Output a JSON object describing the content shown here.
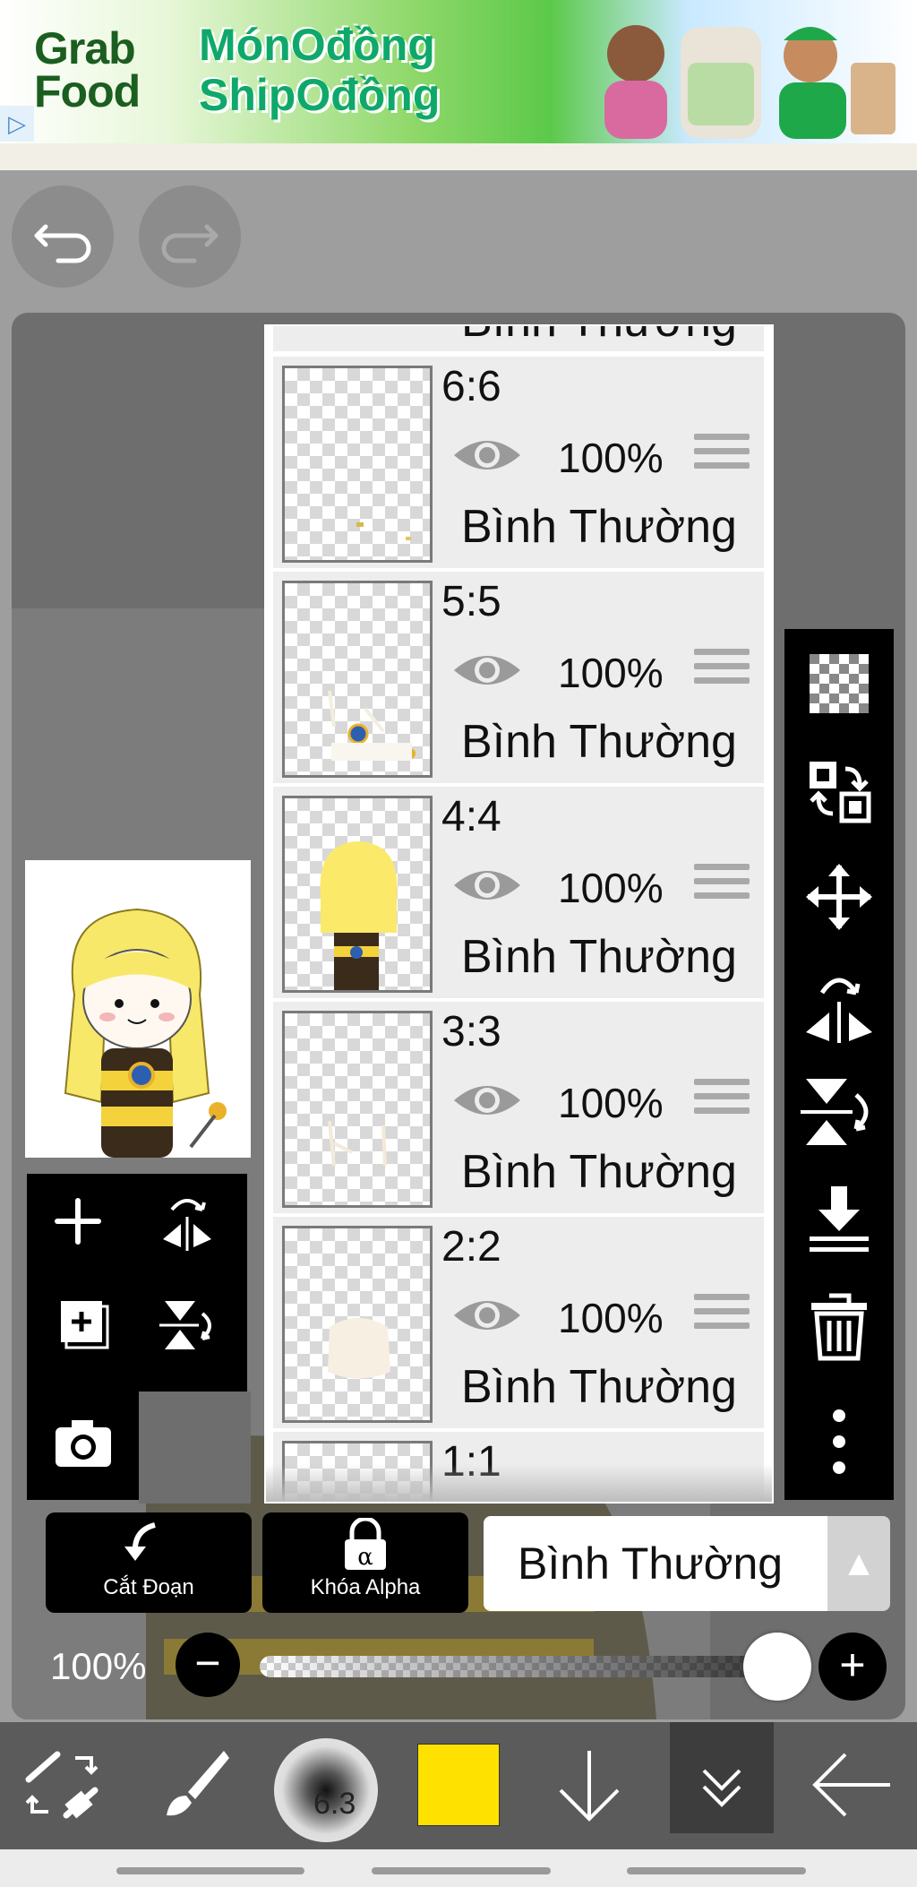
{
  "ad": {
    "brand": "Grab Food",
    "slogan": "MónOđồng ShipOđồng",
    "marker": "▷"
  },
  "toolbar_top": {
    "undo_icon": "undo-icon",
    "redo_icon": "redo-icon"
  },
  "layers": {
    "top_partial_mode": "Bình Thường",
    "items": [
      {
        "name": "6:6",
        "opacity": "100%",
        "mode": "Bình Thường"
      },
      {
        "name": "5:5",
        "opacity": "100%",
        "mode": "Bình Thường"
      },
      {
        "name": "4:4",
        "opacity": "100%",
        "mode": "Bình Thường"
      },
      {
        "name": "3:3",
        "opacity": "100%",
        "mode": "Bình Thường"
      },
      {
        "name": "2:2",
        "opacity": "100%",
        "mode": "Bình Thường"
      },
      {
        "name": "1:1",
        "opacity": "",
        "mode": ""
      }
    ]
  },
  "left_tools": [
    "add-layer-icon",
    "flip-horizontal-icon",
    "duplicate-layer-icon",
    "flip-vertical-icon",
    "camera-icon"
  ],
  "right_tools": [
    "transparent-icon",
    "swap-icon",
    "move-icon",
    "flip-rotate-icon",
    "flip-vertical-rotate-icon",
    "merge-down-icon",
    "trash-icon",
    "more-icon"
  ],
  "bottom_controls": {
    "cut_label": "Cắt Đoạn",
    "alpha_label": "Khóa Alpha",
    "blend_mode": "Bình Thường",
    "opacity_label": "100%",
    "opacity_value": 1.0
  },
  "bottom_toolbar": {
    "brush_size": "6.3",
    "color": "#ffe100"
  },
  "colors": {
    "accent_black": "#000000",
    "panel_gray": "#ededed",
    "toolbar_gray": "#5b5b5b"
  }
}
